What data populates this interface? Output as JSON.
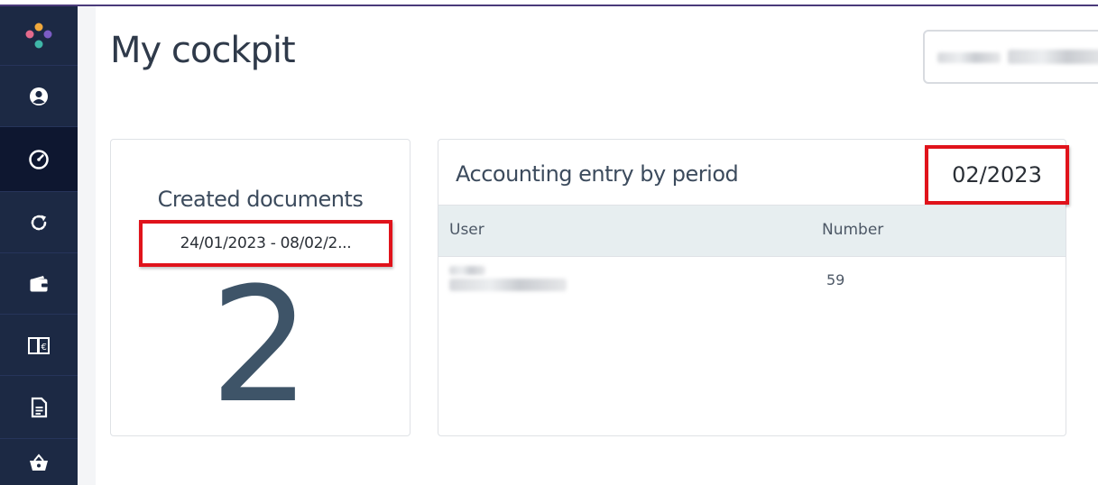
{
  "page": {
    "title": "My cockpit",
    "search_value": ""
  },
  "sidebar": {
    "items": [
      {
        "icon": "logo-icon"
      },
      {
        "icon": "user-circle-icon"
      },
      {
        "icon": "dashboard-gauge-icon",
        "active": true
      },
      {
        "icon": "refresh-icon"
      },
      {
        "icon": "wallet-icon"
      },
      {
        "icon": "ledger-book-euro-icon"
      },
      {
        "icon": "document-icon"
      },
      {
        "icon": "shopping-basket-icon"
      }
    ]
  },
  "created_documents": {
    "title": "Created documents",
    "date_range": "24/01/2023 - 08/02/2...",
    "count": "2"
  },
  "accounting_entry": {
    "title": "Accounting entry by period",
    "period": "02/2023",
    "columns": {
      "user": "User",
      "number": "Number"
    },
    "rows": [
      {
        "user": "",
        "number": "59"
      }
    ]
  },
  "colors": {
    "sidebar_bg": "#1c2944",
    "highlight_border": "#e0131b",
    "table_header_bg": "#e7eef0",
    "big_number": "#3e5468"
  }
}
